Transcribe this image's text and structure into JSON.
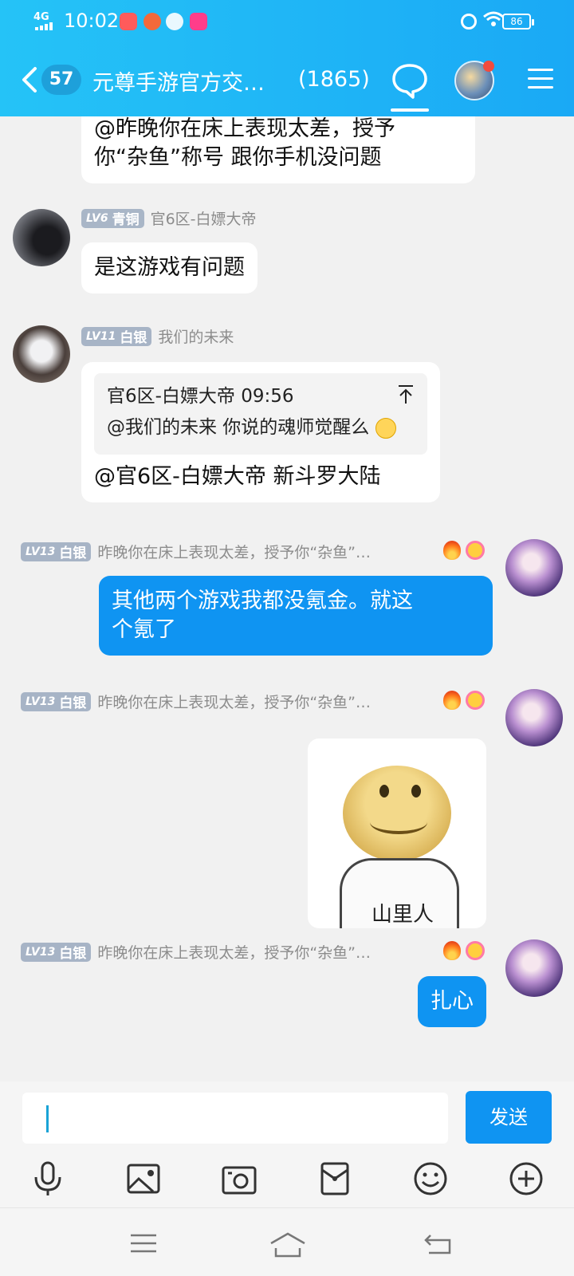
{
  "status_bar": {
    "network": "4G",
    "time": "10:02",
    "battery": "86"
  },
  "header": {
    "unread_count": "57",
    "group_title": "元尊手游官方交…",
    "member_count": "(1865)"
  },
  "messages": [
    {
      "text_line1": "@昨晚你在床上表现太差，授予",
      "text_line2": "你“杂鱼”称号 跟你手机没问题"
    },
    {
      "level": "LV6",
      "rank": "青铜",
      "sender": "官6区-白嫖大帝",
      "text": "是这游戏有问题"
    },
    {
      "level": "LV11",
      "rank": "白银",
      "sender": "我们的未来",
      "quote_author_time": "官6区-白嫖大帝 09:56",
      "quote_text": "@我们的未来 你说的魂师觉醒么",
      "text": "@官6区-白嫖大帝 新斗罗大陆"
    },
    {
      "level": "LV13",
      "rank": "白银",
      "sender": "昨晚你在床上表现太差，授予你“杂鱼”…",
      "text_line1": "其他两个游戏我都没氪金。就这",
      "text_line2": "个氪了"
    },
    {
      "level": "LV13",
      "rank": "白银",
      "sender": "昨晚你在床上表现太差，授予你“杂鱼”…",
      "sticker_caption": "山里人"
    },
    {
      "level": "LV13",
      "rank": "白银",
      "sender": "昨晚你在床上表现太差，授予你“杂鱼”…",
      "text": "扎心"
    }
  ],
  "input": {
    "send_label": "发送"
  },
  "icons": {
    "tools": [
      "microphone-icon",
      "image-icon",
      "camera-icon",
      "red-packet-icon",
      "emoji-icon",
      "plus-icon"
    ],
    "nav": [
      "menu-icon",
      "home-icon",
      "back-icon"
    ]
  },
  "colors": {
    "header": "#1aa9f5",
    "own_bubble": "#0f94f2",
    "send_button": "#0f94f2",
    "level_badge": "#a7b4c6"
  }
}
